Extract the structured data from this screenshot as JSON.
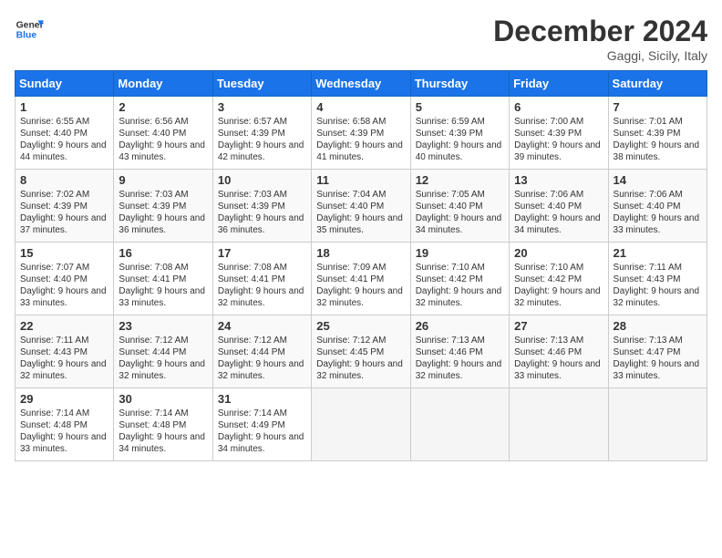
{
  "logo": {
    "line1": "General",
    "line2": "Blue"
  },
  "title": "December 2024",
  "subtitle": "Gaggi, Sicily, Italy",
  "headers": [
    "Sunday",
    "Monday",
    "Tuesday",
    "Wednesday",
    "Thursday",
    "Friday",
    "Saturday"
  ],
  "weeks": [
    [
      {
        "day": "1",
        "sunrise": "6:55 AM",
        "sunset": "4:40 PM",
        "daylight": "9 hours and 44 minutes."
      },
      {
        "day": "2",
        "sunrise": "6:56 AM",
        "sunset": "4:40 PM",
        "daylight": "9 hours and 43 minutes."
      },
      {
        "day": "3",
        "sunrise": "6:57 AM",
        "sunset": "4:39 PM",
        "daylight": "9 hours and 42 minutes."
      },
      {
        "day": "4",
        "sunrise": "6:58 AM",
        "sunset": "4:39 PM",
        "daylight": "9 hours and 41 minutes."
      },
      {
        "day": "5",
        "sunrise": "6:59 AM",
        "sunset": "4:39 PM",
        "daylight": "9 hours and 40 minutes."
      },
      {
        "day": "6",
        "sunrise": "7:00 AM",
        "sunset": "4:39 PM",
        "daylight": "9 hours and 39 minutes."
      },
      {
        "day": "7",
        "sunrise": "7:01 AM",
        "sunset": "4:39 PM",
        "daylight": "9 hours and 38 minutes."
      }
    ],
    [
      {
        "day": "8",
        "sunrise": "7:02 AM",
        "sunset": "4:39 PM",
        "daylight": "9 hours and 37 minutes."
      },
      {
        "day": "9",
        "sunrise": "7:03 AM",
        "sunset": "4:39 PM",
        "daylight": "9 hours and 36 minutes."
      },
      {
        "day": "10",
        "sunrise": "7:03 AM",
        "sunset": "4:39 PM",
        "daylight": "9 hours and 36 minutes."
      },
      {
        "day": "11",
        "sunrise": "7:04 AM",
        "sunset": "4:40 PM",
        "daylight": "9 hours and 35 minutes."
      },
      {
        "day": "12",
        "sunrise": "7:05 AM",
        "sunset": "4:40 PM",
        "daylight": "9 hours and 34 minutes."
      },
      {
        "day": "13",
        "sunrise": "7:06 AM",
        "sunset": "4:40 PM",
        "daylight": "9 hours and 34 minutes."
      },
      {
        "day": "14",
        "sunrise": "7:06 AM",
        "sunset": "4:40 PM",
        "daylight": "9 hours and 33 minutes."
      }
    ],
    [
      {
        "day": "15",
        "sunrise": "7:07 AM",
        "sunset": "4:40 PM",
        "daylight": "9 hours and 33 minutes."
      },
      {
        "day": "16",
        "sunrise": "7:08 AM",
        "sunset": "4:41 PM",
        "daylight": "9 hours and 33 minutes."
      },
      {
        "day": "17",
        "sunrise": "7:08 AM",
        "sunset": "4:41 PM",
        "daylight": "9 hours and 32 minutes."
      },
      {
        "day": "18",
        "sunrise": "7:09 AM",
        "sunset": "4:41 PM",
        "daylight": "9 hours and 32 minutes."
      },
      {
        "day": "19",
        "sunrise": "7:10 AM",
        "sunset": "4:42 PM",
        "daylight": "9 hours and 32 minutes."
      },
      {
        "day": "20",
        "sunrise": "7:10 AM",
        "sunset": "4:42 PM",
        "daylight": "9 hours and 32 minutes."
      },
      {
        "day": "21",
        "sunrise": "7:11 AM",
        "sunset": "4:43 PM",
        "daylight": "9 hours and 32 minutes."
      }
    ],
    [
      {
        "day": "22",
        "sunrise": "7:11 AM",
        "sunset": "4:43 PM",
        "daylight": "9 hours and 32 minutes."
      },
      {
        "day": "23",
        "sunrise": "7:12 AM",
        "sunset": "4:44 PM",
        "daylight": "9 hours and 32 minutes."
      },
      {
        "day": "24",
        "sunrise": "7:12 AM",
        "sunset": "4:44 PM",
        "daylight": "9 hours and 32 minutes."
      },
      {
        "day": "25",
        "sunrise": "7:12 AM",
        "sunset": "4:45 PM",
        "daylight": "9 hours and 32 minutes."
      },
      {
        "day": "26",
        "sunrise": "7:13 AM",
        "sunset": "4:46 PM",
        "daylight": "9 hours and 32 minutes."
      },
      {
        "day": "27",
        "sunrise": "7:13 AM",
        "sunset": "4:46 PM",
        "daylight": "9 hours and 33 minutes."
      },
      {
        "day": "28",
        "sunrise": "7:13 AM",
        "sunset": "4:47 PM",
        "daylight": "9 hours and 33 minutes."
      }
    ],
    [
      {
        "day": "29",
        "sunrise": "7:14 AM",
        "sunset": "4:48 PM",
        "daylight": "9 hours and 33 minutes."
      },
      {
        "day": "30",
        "sunrise": "7:14 AM",
        "sunset": "4:48 PM",
        "daylight": "9 hours and 34 minutes."
      },
      {
        "day": "31",
        "sunrise": "7:14 AM",
        "sunset": "4:49 PM",
        "daylight": "9 hours and 34 minutes."
      },
      null,
      null,
      null,
      null
    ]
  ],
  "labels": {
    "sunrise": "Sunrise:",
    "sunset": "Sunset:",
    "daylight": "Daylight:"
  }
}
